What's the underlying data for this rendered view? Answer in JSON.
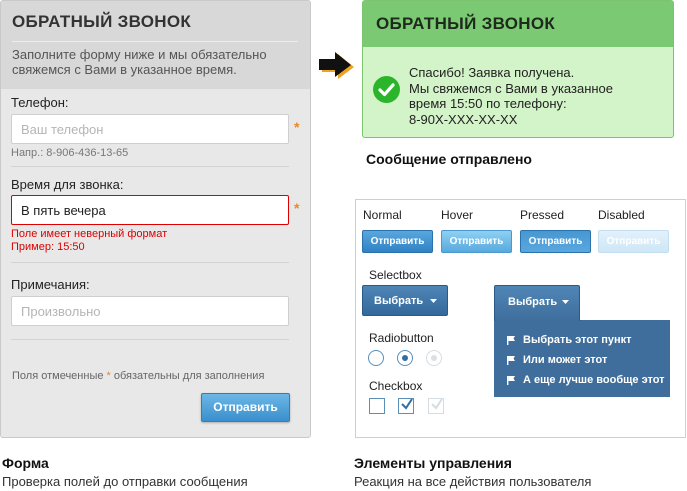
{
  "form": {
    "title": "ОБРАТНЫЙ ЗВОНОК",
    "description": "Заполните форму ниже и мы обязательно свяжемся с Вами в указанное время.",
    "phone": {
      "label": "Телефон:",
      "placeholder": "Ваш телефон",
      "hint": "Напр.: 8-906-436-13-65",
      "required_mark": "*"
    },
    "time": {
      "label": "Время для звонка:",
      "value": "В пять вечера",
      "required_mark": "*",
      "error_line1": "Поле имеет неверный формат",
      "error_line2": "Пример: 15:50"
    },
    "notes": {
      "label": "Примечания:",
      "placeholder": "Произвольно"
    },
    "footnote_before": "Поля отмеченные ",
    "footnote_star": "*",
    "footnote_after": " обязательны для заполнения",
    "submit_label": "Отправить"
  },
  "form_caption": {
    "title": "Форма",
    "subtitle": "Проверка полей до отправки сообщения"
  },
  "success": {
    "title": "ОБРАТНЫЙ ЗВОНОК",
    "line1": "Спасибо! Заявка получена.",
    "line2": "Мы свяжемся с Вами в указанное",
    "line3": "время 15:50 по телефону:",
    "line4": "8-90X-XXX-XX-XX",
    "caption": "Сообщение отправлено",
    "color": "#7cc973"
  },
  "controls": {
    "states": [
      {
        "label": "Normal",
        "button": "Отправить"
      },
      {
        "label": "Hover",
        "button": "Отправить"
      },
      {
        "label": "Pressed",
        "button": "Отправить"
      },
      {
        "label": "Disabled",
        "button": "Отправить"
      }
    ],
    "selectbox_label": "Selectbox",
    "select_label": "Выбрать",
    "dropdown_items": [
      "Выбрать этот пункт",
      "Или может этот",
      "А еще лучше вообще этот"
    ],
    "radiobutton_label": "Radiobutton",
    "checkbox_label": "Checkbox",
    "accent": "#3f6e9c"
  },
  "controls_caption": {
    "title": "Элементы управления",
    "subtitle": "Реакция на все действия пользователя"
  }
}
